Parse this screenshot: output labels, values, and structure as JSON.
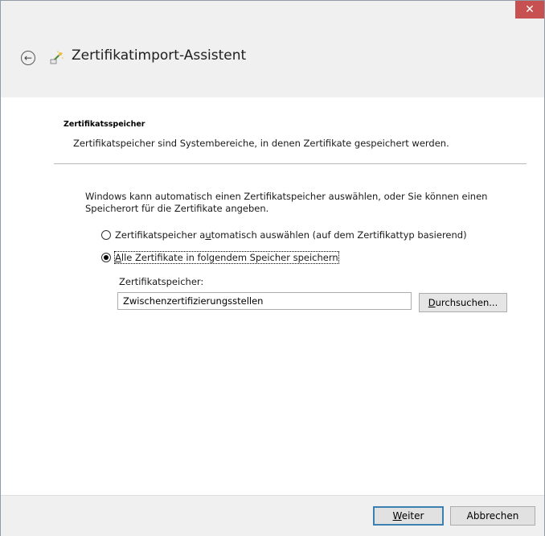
{
  "window": {
    "title": "Zertifikatimport-Assistent",
    "close_label": "✕"
  },
  "section": {
    "heading": "Zertifikatsspeicher",
    "description": "Zertifikatspeicher sind Systembereiche, in denen Zertifikate gespeichert werden."
  },
  "intro": "Windows kann automatisch einen Zertifikatspeicher auswählen, oder Sie können einen Speicherort für die Zertifikate angeben.",
  "options": [
    {
      "label_pre": "Zertifikatspeicher a",
      "label_key": "u",
      "label_post": "tomatisch auswählen (auf dem Zertifikattyp basierend)",
      "selected": false
    },
    {
      "label_pre": "",
      "label_key": "A",
      "label_post": "lle Zertifikate in folgendem Speicher speichern",
      "selected": true
    }
  ],
  "store": {
    "label": "Zertifikatspeicher:",
    "value": "Zwischenzertifizierungsstellen"
  },
  "browse_button": {
    "key": "D",
    "rest": "urchsuchen..."
  },
  "footer": {
    "next": {
      "key": "W",
      "rest": "eiter"
    },
    "cancel": "Abbrechen"
  },
  "icons": {
    "back": "back-arrow-icon",
    "wizard": "certificate-wizard-icon",
    "close": "close-icon"
  },
  "colors": {
    "close_button": "#c75050",
    "chrome": "#f0f0f0",
    "default_button_border": "#3c7fb1"
  }
}
